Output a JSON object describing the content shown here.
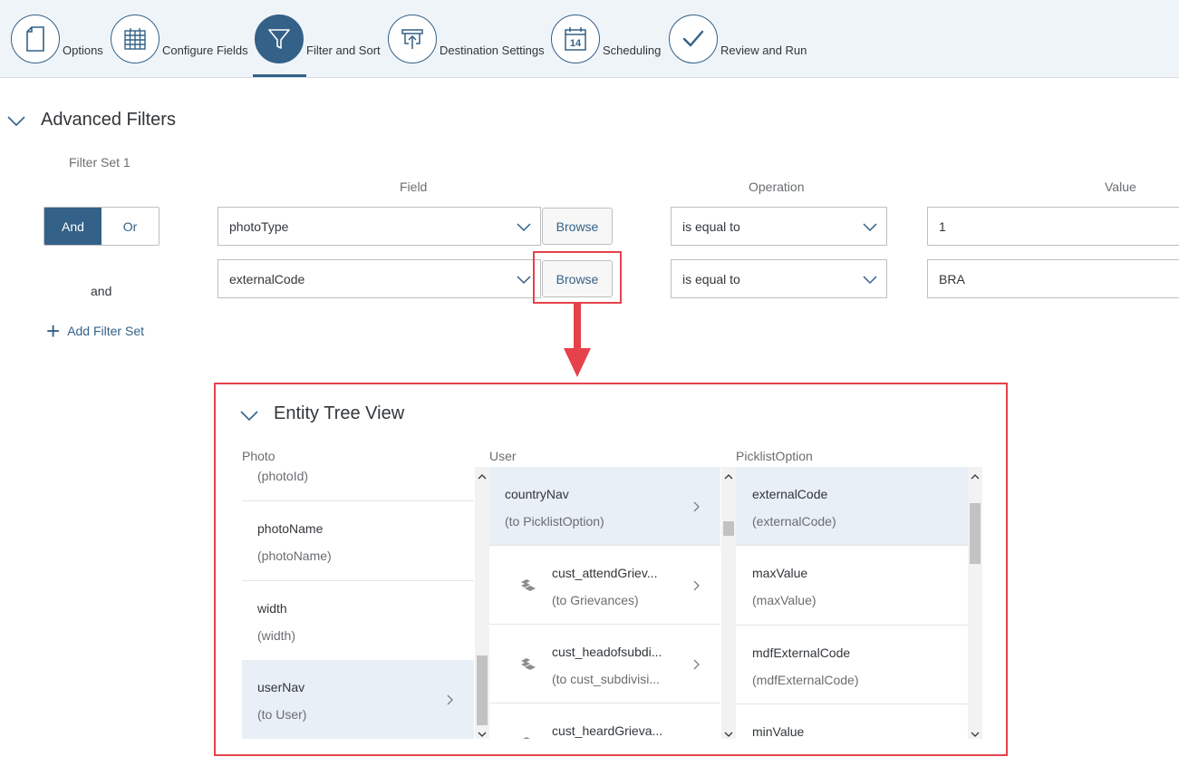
{
  "wizard": {
    "steps": [
      {
        "label": "Options",
        "icon": "document-icon"
      },
      {
        "label": "Configure Fields",
        "icon": "table-grid-icon"
      },
      {
        "label": "Filter and Sort",
        "icon": "filter-icon"
      },
      {
        "label": "Destination Settings",
        "icon": "upload-icon"
      },
      {
        "label": "Scheduling",
        "icon": "calendar-icon"
      },
      {
        "label": "Review and Run",
        "icon": "checkmark-icon"
      }
    ],
    "active_step": "Filter and Sort",
    "calendar_day": "14"
  },
  "advanced_filters": {
    "title": "Advanced Filters",
    "filter_set_label": "Filter Set 1",
    "columns": {
      "field": "Field",
      "operation": "Operation",
      "value": "Value"
    },
    "logic": {
      "and": "And",
      "or": "Or",
      "selected": "And"
    },
    "rows": [
      {
        "field": "photoType",
        "browse": "Browse",
        "operation": "is equal to",
        "value": "1"
      },
      {
        "field": "externalCode",
        "browse": "Browse",
        "operation": "is equal to",
        "value": "BRA"
      }
    ],
    "connector": "and",
    "add_filter_set": "Add Filter Set"
  },
  "entity_tree": {
    "title": "Entity Tree View",
    "columns": [
      {
        "name": "Photo",
        "items": [
          {
            "label": "",
            "sub": "(photoId)",
            "selected": false
          },
          {
            "label": "photoName",
            "sub": "(photoName)",
            "selected": false
          },
          {
            "label": "width",
            "sub": "(width)",
            "selected": false
          },
          {
            "label": "userNav",
            "sub": "(to User)",
            "selected": true
          }
        ]
      },
      {
        "name": "User",
        "items": [
          {
            "label": "countryNav",
            "sub": "(to PicklistOption)",
            "selected": true
          },
          {
            "label": "cust_attendGriev...",
            "sub": "(to Grievances)",
            "selected": false
          },
          {
            "label": "cust_headofsubdi...",
            "sub": "(to cust_subdivisi...",
            "selected": false
          },
          {
            "label": "cust_heardGrieva...",
            "sub": "",
            "selected": false
          }
        ]
      },
      {
        "name": "PicklistOption",
        "items": [
          {
            "label": "externalCode",
            "sub": "(externalCode)",
            "selected": true
          },
          {
            "label": "maxValue",
            "sub": "(maxValue)",
            "selected": false
          },
          {
            "label": "mdfExternalCode",
            "sub": "(mdfExternalCode)",
            "selected": false
          },
          {
            "label": "minValue",
            "sub": "",
            "selected": false
          }
        ]
      }
    ]
  },
  "colors": {
    "accent": "#346187",
    "highlight": "#e5424b",
    "selected_row": "#e8eff6",
    "wizard_bg": "#eff4f9"
  }
}
